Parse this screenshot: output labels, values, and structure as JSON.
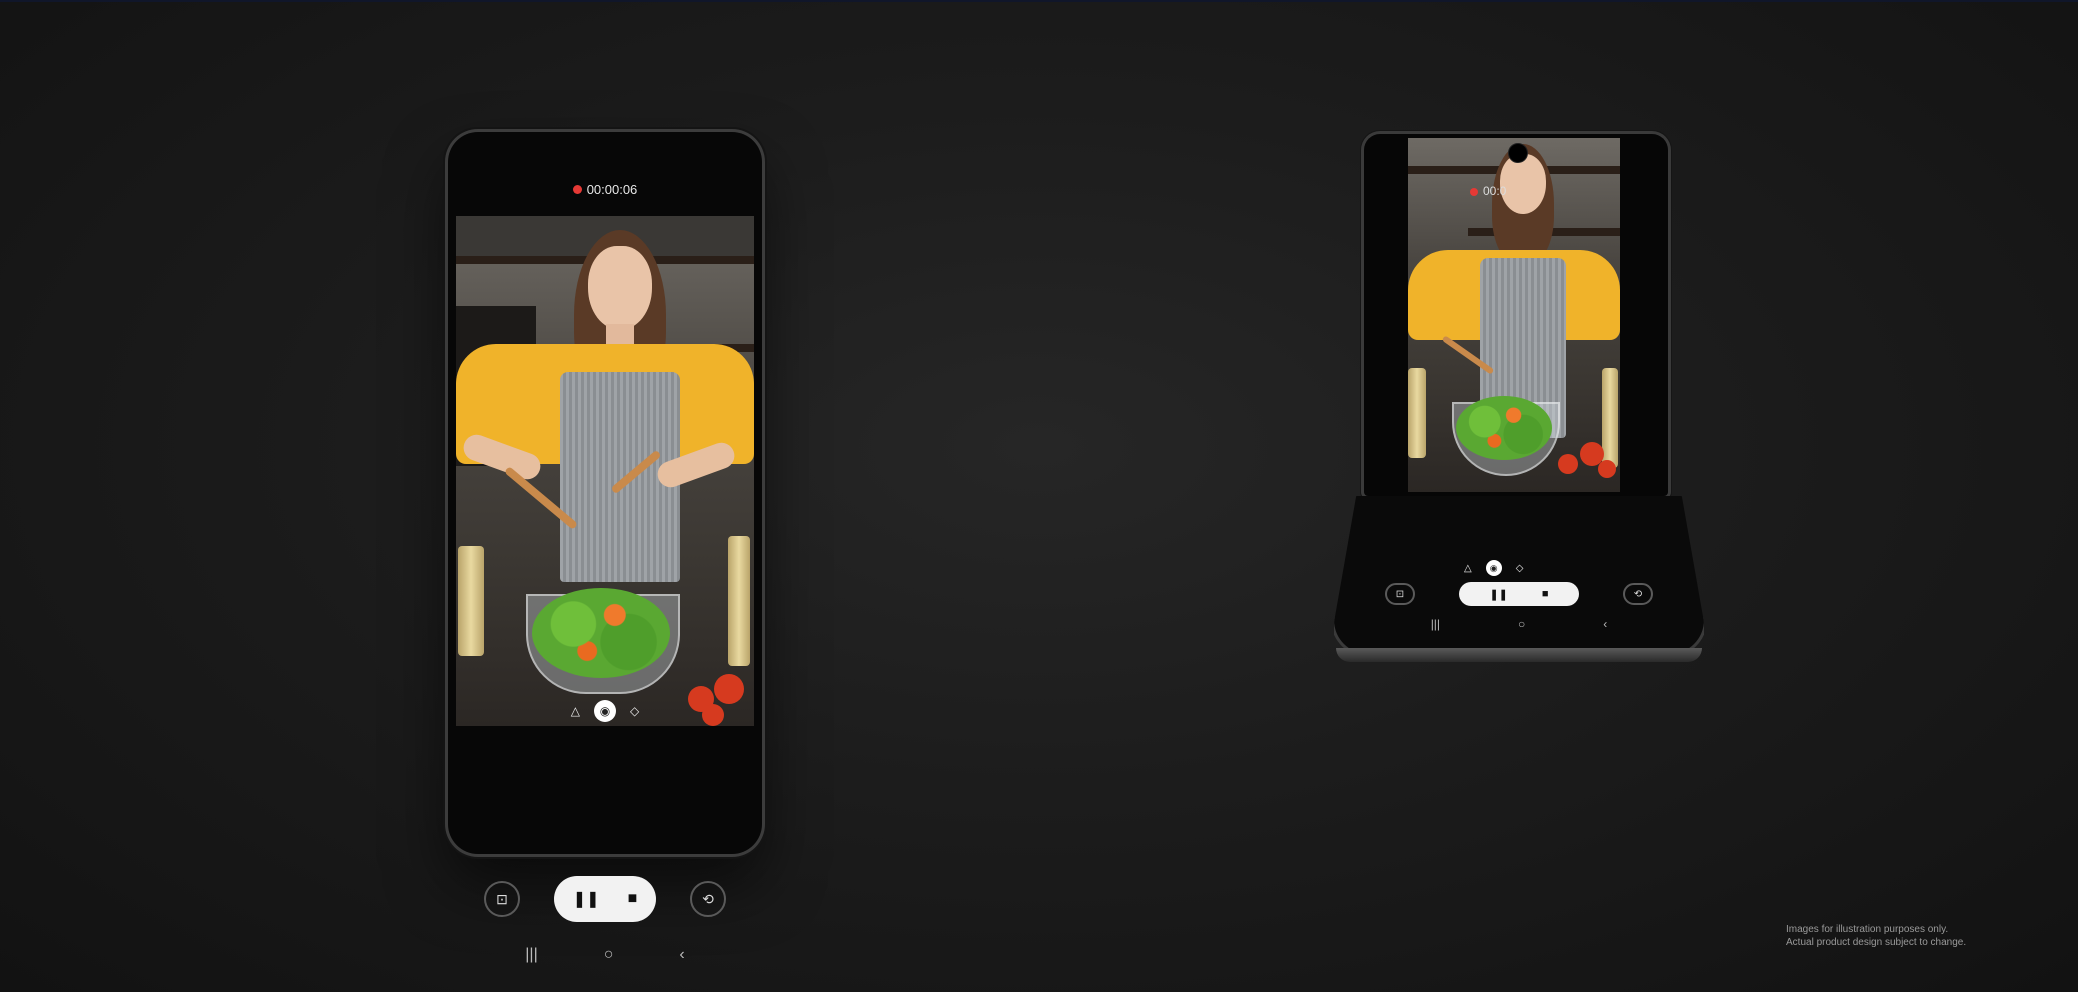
{
  "recording": {
    "time_main": "00:00:06",
    "time_flip": "00:0",
    "indicator_color": "#e53935"
  },
  "filters": {
    "icons": [
      "triangle-drop-icon",
      "drop-icon",
      "diamond-drop-icon"
    ],
    "icon_glyphs": [
      "△",
      "◉",
      "◇"
    ],
    "active_index": 1
  },
  "controls": {
    "snapshot_icon": "⊡",
    "pause_icon": "❚❚",
    "stop_icon": "■",
    "switch_camera_icon": "⟲"
  },
  "navbar": {
    "recents_icon": "|||",
    "home_icon": "○",
    "back_icon": "‹"
  },
  "disclaimer": {
    "line1": "Images for illustration purposes only.",
    "line2": "Actual product design subject to change."
  },
  "colors": {
    "background": "#1c1c1c",
    "shirt": "#f0b32a",
    "pill_bg": "#f2f2f2"
  }
}
